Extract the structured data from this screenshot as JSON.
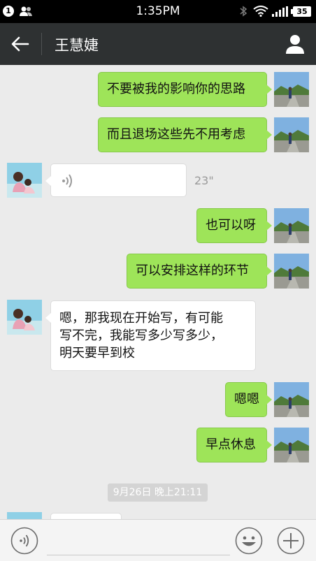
{
  "status_bar": {
    "notification_count": "1",
    "time": "1:35PM",
    "battery": "35",
    "icons": [
      "contacts-icon",
      "bluetooth-icon",
      "wifi-icon",
      "signal-icon",
      "battery-icon"
    ]
  },
  "header": {
    "back_icon": "arrow-left-icon",
    "title": "王慧婕",
    "profile_icon": "person-icon"
  },
  "messages": [
    {
      "from": "me",
      "type": "text",
      "text": "不要被我的影响你的思路"
    },
    {
      "from": "me",
      "type": "text",
      "text": "而且退场这些先不用考虑"
    },
    {
      "from": "them",
      "type": "voice",
      "duration": "23\""
    },
    {
      "from": "me",
      "type": "text",
      "text": "也可以呀"
    },
    {
      "from": "me",
      "type": "text",
      "text": "可以安排这样的环节"
    },
    {
      "from": "them",
      "type": "text",
      "lines": [
        "嗯，那我现在开始写，有可能",
        "写不完，我能写多少写多少，",
        "明天要早到校"
      ]
    },
    {
      "from": "me",
      "type": "text",
      "text": "嗯嗯"
    },
    {
      "from": "me",
      "type": "text",
      "text": "早点休息"
    }
  ],
  "timestamp": "9月26日 晚上21:11",
  "input_bar": {
    "voice_icon": "voice-icon",
    "input_value": "",
    "emoji_icon": "emoji-icon",
    "plus_icon": "plus-icon"
  },
  "colors": {
    "sent_bubble": "#9ee459",
    "received_bubble": "#ffffff",
    "header_bg": "#2e3132",
    "chat_bg": "#ebebeb"
  }
}
